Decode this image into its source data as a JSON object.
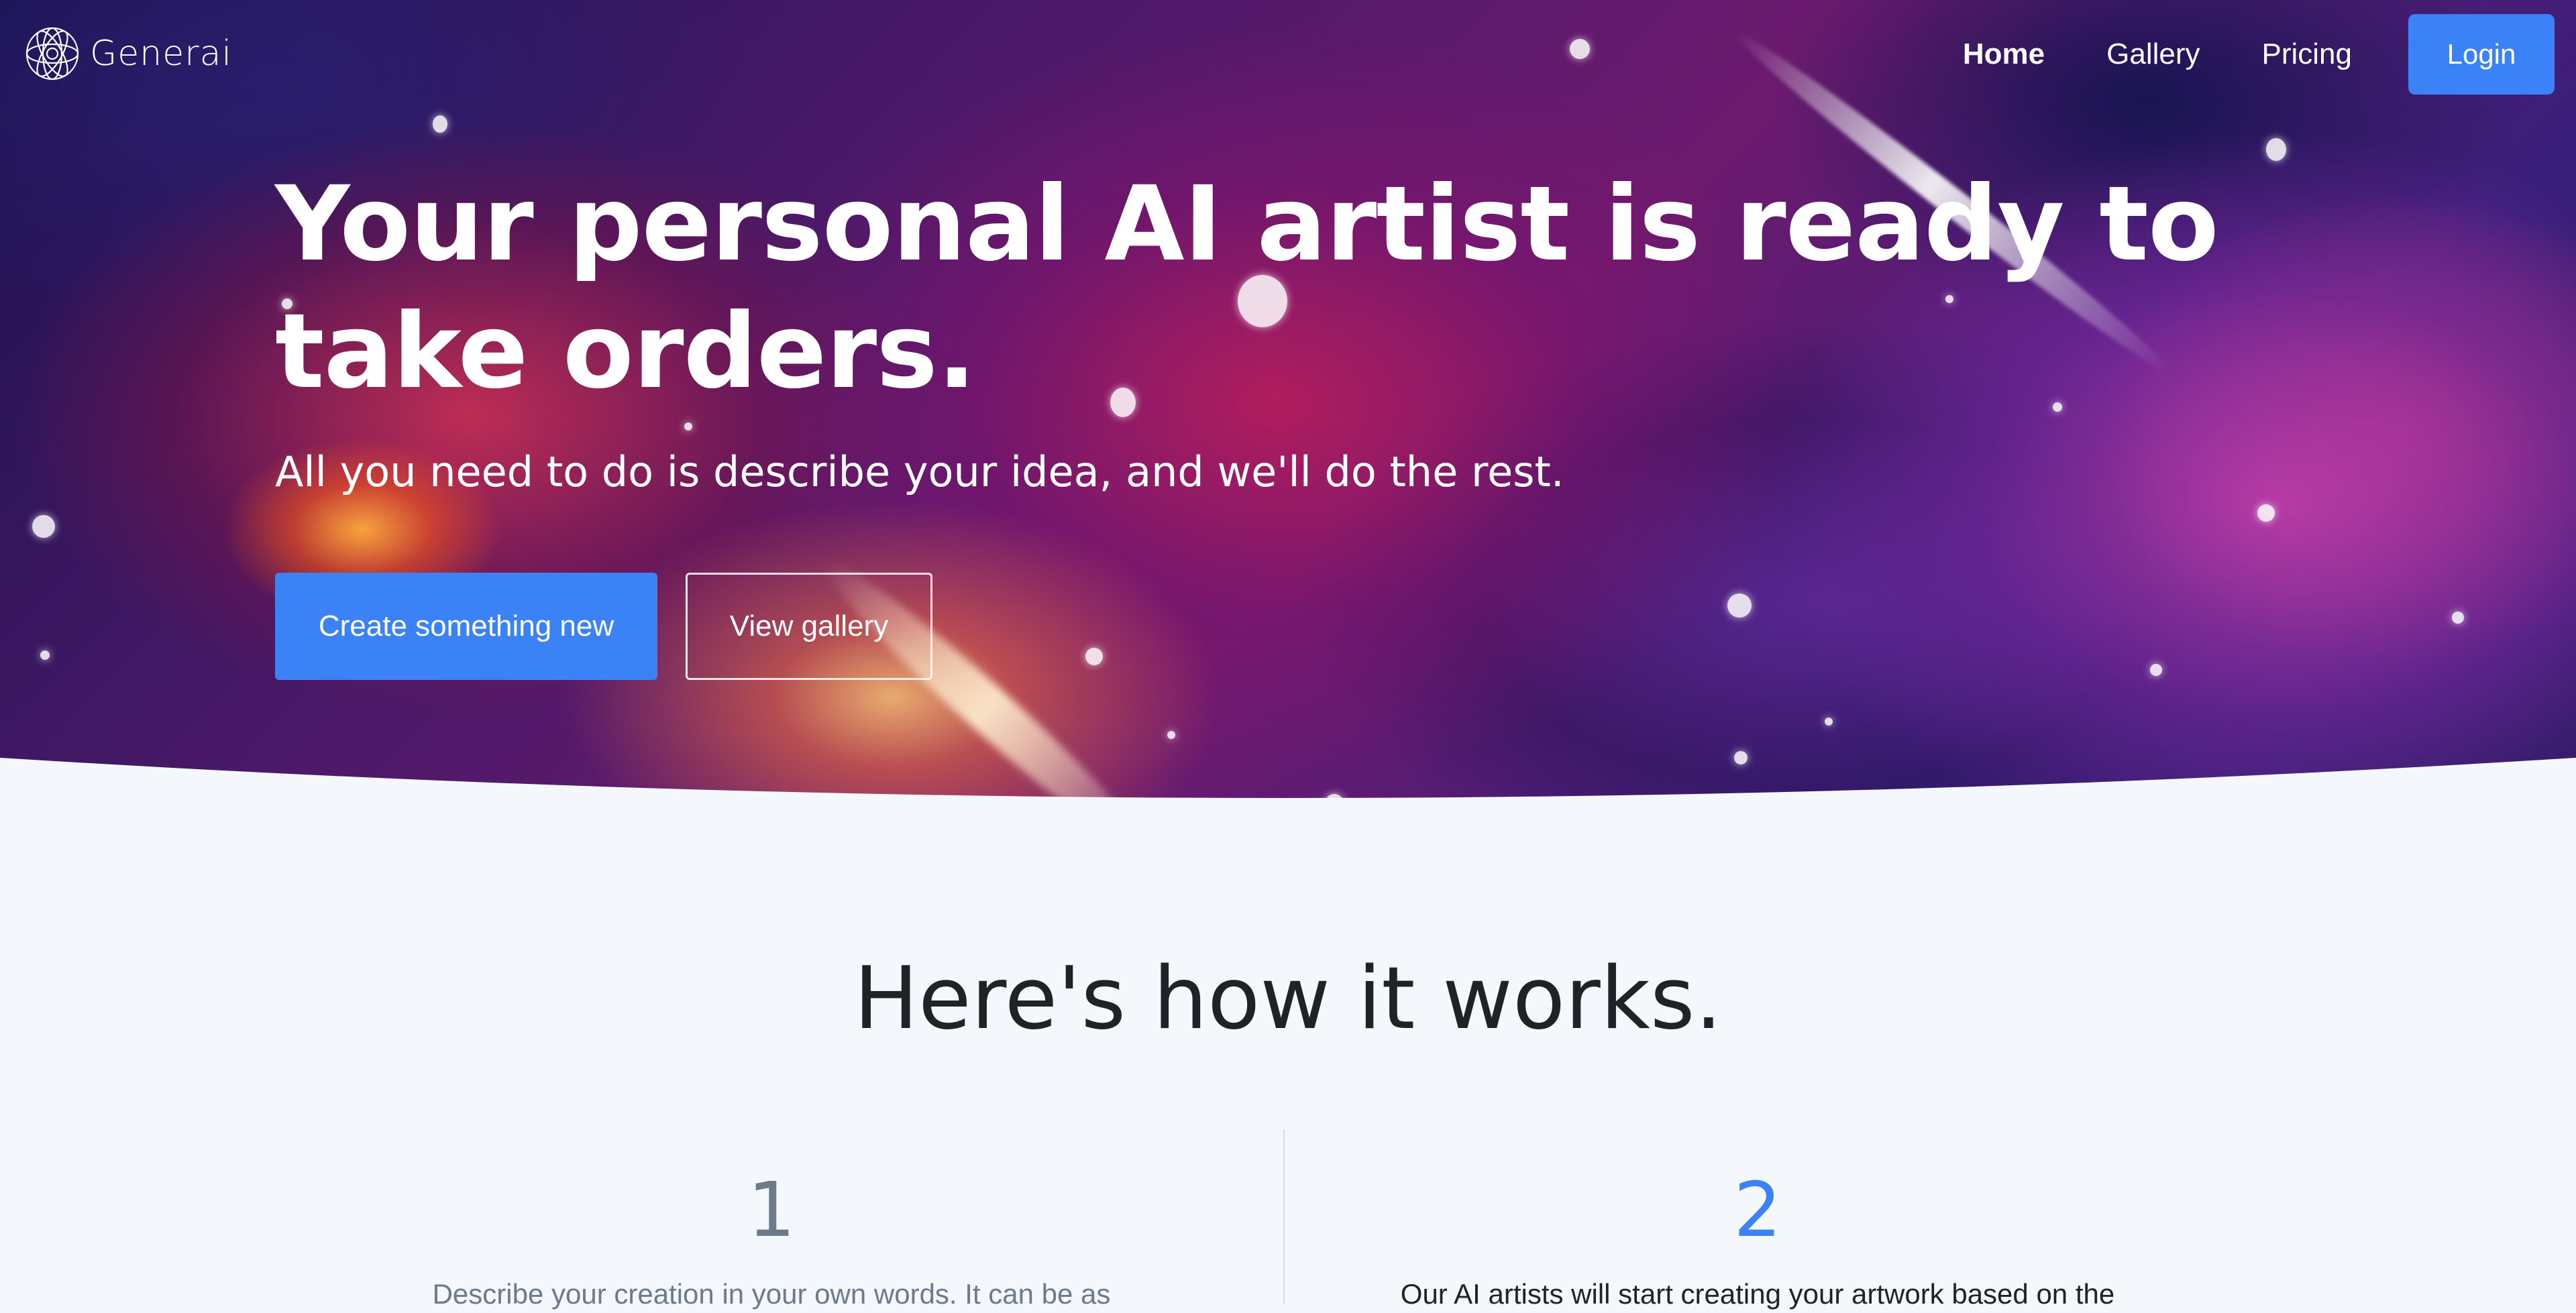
{
  "colors": {
    "accent": "#3b82f6",
    "page_background": "#f4f7fc",
    "heading_text": "#1f2328",
    "muted_text": "#6c7a89",
    "hero_theme": "#4a1968"
  },
  "nav": {
    "logo_icon": "geometric-sphere-icon",
    "brand": "Generai",
    "links": [
      "Home",
      "Gallery",
      "Pricing"
    ],
    "active_link": "Home",
    "login_label": "Login"
  },
  "hero": {
    "headline": "Your personal AI artist is ready to take orders.",
    "subheadline": "All you need to do is describe your idea, and we'll do the rest.",
    "primary_cta": "Create something new",
    "secondary_cta": "View gallery"
  },
  "how_it_works": {
    "title": "Here's how it works.",
    "steps": [
      {
        "number": "1",
        "text": "Describe your creation in your own words. It can be as"
      },
      {
        "number": "2",
        "text": "Our AI artists will start creating your artwork based on the"
      }
    ]
  }
}
